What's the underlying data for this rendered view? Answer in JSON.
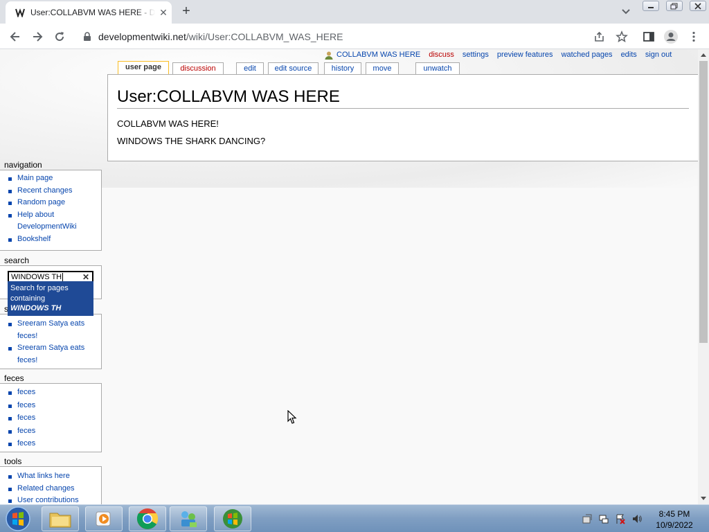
{
  "browser": {
    "tab_title": "User:COLLABVM WAS HERE - DevelopmentWiki",
    "url_host": "developmentwiki.net",
    "url_path": "/wiki/User:COLLABVM_WAS_HERE"
  },
  "personal": {
    "username": "COLLABVM WAS HERE",
    "links": [
      "discuss",
      "settings",
      "preview features",
      "watched pages",
      "edits",
      "sign out"
    ]
  },
  "page_tabs": [
    "user page",
    "discussion",
    "edit",
    "edit source",
    "history",
    "move",
    "unwatch"
  ],
  "article": {
    "heading": "User:COLLABVM WAS HERE",
    "paragraphs": [
      "COLLABVM WAS HERE!",
      "WINDOWS THE SHARK DANCING?"
    ]
  },
  "sidebar": {
    "navigation": {
      "title": "navigation",
      "items": [
        "Main page",
        "Recent changes",
        "Random page",
        "Help about",
        "DevelopmentWiki",
        "Bookshelf"
      ]
    },
    "search": {
      "title": "search",
      "value": "WINDOWS TH",
      "suggest_line1": "Search for pages",
      "suggest_line2": "containing",
      "suggest_term": "WINDOWS TH"
    },
    "custom": {
      "title_visible": "s",
      "items": [
        "Sreeram Satya eats",
        "feces!",
        "Sreeram Satya eats",
        "feces!"
      ]
    },
    "feces": {
      "title": "feces",
      "items": [
        "feces",
        "feces",
        "feces",
        "feces",
        "feces"
      ]
    },
    "tools": {
      "title": "tools",
      "items": [
        "What links here",
        "Related changes",
        "User contributions"
      ]
    }
  },
  "taskbar": {
    "time": "8:45 PM",
    "date": "10/9/2022"
  }
}
